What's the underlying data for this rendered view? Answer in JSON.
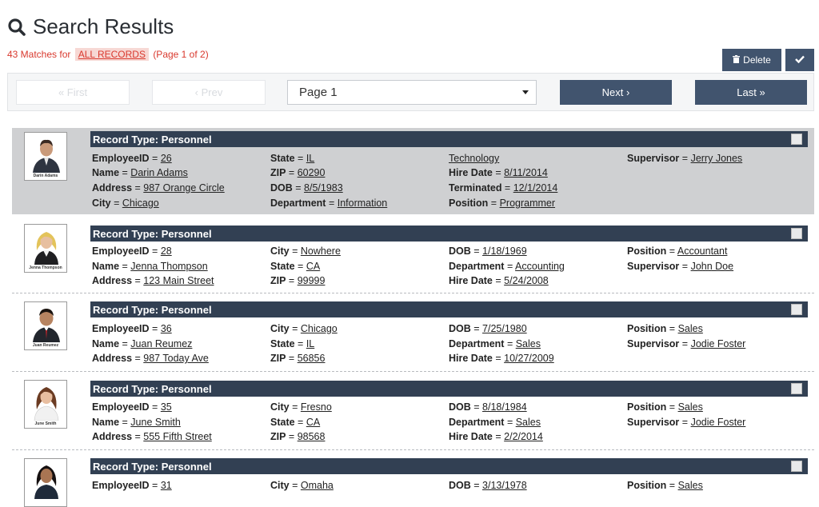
{
  "header": {
    "title": "Search Results",
    "matches_prefix": "43 Matches for",
    "matches_query": "ALL RECORDS",
    "matches_suffix": "(Page 1 of 2)"
  },
  "toolbar": {
    "delete_label": "Delete"
  },
  "pager": {
    "first_label": "« First",
    "prev_label": "‹ Prev",
    "page_select_value": "Page 1",
    "next_label": "Next ›",
    "last_label": "Last »"
  },
  "records": [
    {
      "type_label": "Record Type: Personnel",
      "photo_caption": "Darin Adams",
      "selected": true,
      "fields": [
        [
          "EmployeeID",
          "26"
        ],
        [
          "Name",
          "Darin Adams"
        ],
        [
          "Address",
          "987 Orange Circle"
        ],
        [
          "City",
          "Chicago"
        ],
        [
          "State",
          "IL"
        ],
        [
          "ZIP",
          "60290"
        ],
        [
          "DOB",
          "8/5/1983"
        ],
        [
          "Department",
          "Information"
        ],
        [
          "",
          "Technology"
        ],
        [
          "Hire Date",
          "8/11/2014"
        ],
        [
          "Terminated",
          "12/1/2014"
        ],
        [
          "Position",
          "Programmer"
        ],
        [
          "Supervisor",
          "Jerry Jones"
        ]
      ]
    },
    {
      "type_label": "Record Type: Personnel",
      "photo_caption": "Jenna Thompson",
      "fields": [
        [
          "EmployeeID",
          "28"
        ],
        [
          "Name",
          "Jenna Thompson"
        ],
        [
          "Address",
          "123 Main Street"
        ],
        [
          "City",
          "Nowhere"
        ],
        [
          "State",
          "CA"
        ],
        [
          "ZIP",
          "99999"
        ],
        [
          "DOB",
          "1/18/1969"
        ],
        [
          "Department",
          "Accounting"
        ],
        [
          "Hire Date",
          "5/24/2008"
        ],
        [
          "Position",
          "Accountant"
        ],
        [
          "Supervisor",
          "John Doe"
        ]
      ]
    },
    {
      "type_label": "Record Type: Personnel",
      "photo_caption": "Juan Reumez",
      "fields": [
        [
          "EmployeeID",
          "36"
        ],
        [
          "Name",
          "Juan Reumez"
        ],
        [
          "Address",
          "987 Today Ave"
        ],
        [
          "City",
          "Chicago"
        ],
        [
          "State",
          "IL"
        ],
        [
          "ZIP",
          "56856"
        ],
        [
          "DOB",
          "7/25/1980"
        ],
        [
          "Department",
          "Sales"
        ],
        [
          "Hire Date",
          "10/27/2009"
        ],
        [
          "Position",
          "Sales"
        ],
        [
          "Supervisor",
          "Jodie Foster"
        ]
      ]
    },
    {
      "type_label": "Record Type: Personnel",
      "photo_caption": "June Smith",
      "fields": [
        [
          "EmployeeID",
          "35"
        ],
        [
          "Name",
          "June Smith"
        ],
        [
          "Address",
          "555 Fifth Street"
        ],
        [
          "City",
          "Fresno"
        ],
        [
          "State",
          "CA"
        ],
        [
          "ZIP",
          "98568"
        ],
        [
          "DOB",
          "8/18/1984"
        ],
        [
          "Department",
          "Sales"
        ],
        [
          "Hire Date",
          "2/2/2014"
        ],
        [
          "Position",
          "Sales"
        ],
        [
          "Supervisor",
          "Jodie Foster"
        ]
      ]
    },
    {
      "type_label": "Record Type: Personnel",
      "photo_caption": "",
      "fields": [
        [
          "EmployeeID",
          "31"
        ],
        [
          "City",
          "Omaha"
        ],
        [
          "DOB",
          "3/13/1978"
        ],
        [
          "Position",
          "Sales"
        ]
      ]
    }
  ],
  "colors": {
    "header_bar": "#324053",
    "button": "#41546e",
    "match_text": "#d9392e",
    "selected_row": "#cfd0d2"
  },
  "icons": {
    "title": "search-icon",
    "delete": "trash-icon",
    "confirm": "checkmark-icon"
  }
}
